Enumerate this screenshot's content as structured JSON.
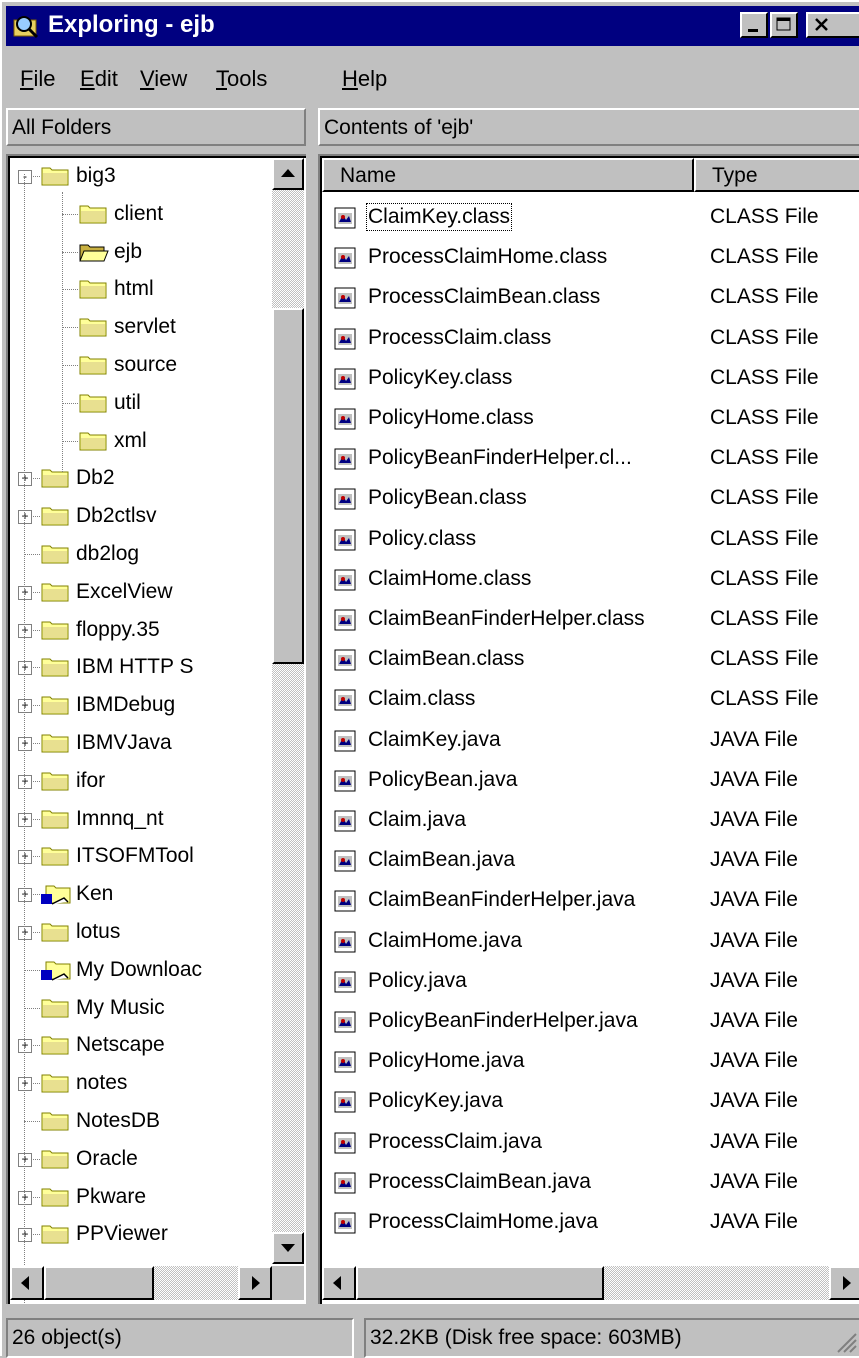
{
  "window": {
    "title": "Exploring - ejb",
    "app_icon": "explorer-icon"
  },
  "menu": [
    "File",
    "Edit",
    "View",
    "Tools",
    "Help"
  ],
  "menu_accel": [
    "F",
    "E",
    "V",
    "T",
    "H"
  ],
  "left_header": "All Folders",
  "right_header": "Contents of 'ejb'",
  "tree": [
    {
      "label": "big3",
      "level": 0,
      "expander": "-",
      "icon": "folder-icon"
    },
    {
      "label": "client",
      "level": 1,
      "expander": "",
      "icon": "folder-icon"
    },
    {
      "label": "ejb",
      "level": 1,
      "expander": "",
      "icon": "open-folder-icon"
    },
    {
      "label": "html",
      "level": 1,
      "expander": "",
      "icon": "folder-icon"
    },
    {
      "label": "servlet",
      "level": 1,
      "expander": "",
      "icon": "folder-icon"
    },
    {
      "label": "source",
      "level": 1,
      "expander": "",
      "icon": "folder-icon"
    },
    {
      "label": "util",
      "level": 1,
      "expander": "",
      "icon": "folder-icon"
    },
    {
      "label": "xml",
      "level": 1,
      "expander": "",
      "icon": "folder-icon"
    },
    {
      "label": "Db2",
      "level": 0,
      "expander": "+",
      "icon": "folder-icon"
    },
    {
      "label": "Db2ctlsv",
      "level": 0,
      "expander": "+",
      "icon": "folder-icon"
    },
    {
      "label": "db2log",
      "level": 0,
      "expander": "",
      "icon": "folder-icon"
    },
    {
      "label": "ExcelView",
      "level": 0,
      "expander": "+",
      "icon": "folder-icon"
    },
    {
      "label": "floppy.35",
      "level": 0,
      "expander": "+",
      "icon": "folder-icon"
    },
    {
      "label": "IBM HTTP S",
      "level": 0,
      "expander": "+",
      "icon": "folder-icon"
    },
    {
      "label": "IBMDebug",
      "level": 0,
      "expander": "+",
      "icon": "folder-icon"
    },
    {
      "label": "IBMVJava",
      "level": 0,
      "expander": "+",
      "icon": "folder-icon"
    },
    {
      "label": "ifor",
      "level": 0,
      "expander": "+",
      "icon": "folder-icon"
    },
    {
      "label": "Imnnq_nt",
      "level": 0,
      "expander": "+",
      "icon": "folder-icon"
    },
    {
      "label": "ITSOFMTool",
      "level": 0,
      "expander": "+",
      "icon": "folder-icon"
    },
    {
      "label": "Ken",
      "level": 0,
      "expander": "+",
      "icon": "shared-folder-icon"
    },
    {
      "label": "lotus",
      "level": 0,
      "expander": "+",
      "icon": "folder-icon"
    },
    {
      "label": "My Downloac",
      "level": 0,
      "expander": "",
      "icon": "shared-folder-icon"
    },
    {
      "label": "My Music",
      "level": 0,
      "expander": "",
      "icon": "folder-icon"
    },
    {
      "label": "Netscape",
      "level": 0,
      "expander": "+",
      "icon": "folder-icon"
    },
    {
      "label": "notes",
      "level": 0,
      "expander": "+",
      "icon": "folder-icon"
    },
    {
      "label": "NotesDB",
      "level": 0,
      "expander": "",
      "icon": "folder-icon"
    },
    {
      "label": "Oracle",
      "level": 0,
      "expander": "+",
      "icon": "folder-icon"
    },
    {
      "label": "Pkware",
      "level": 0,
      "expander": "+",
      "icon": "folder-icon"
    },
    {
      "label": "PPViewer",
      "level": 0,
      "expander": "+",
      "icon": "folder-icon"
    }
  ],
  "columns": [
    "Name",
    "Type"
  ],
  "files": [
    {
      "name": "ClaimKey.class",
      "type": "CLASS File"
    },
    {
      "name": "ProcessClaimHome.class",
      "type": "CLASS File"
    },
    {
      "name": "ProcessClaimBean.class",
      "type": "CLASS File"
    },
    {
      "name": "ProcessClaim.class",
      "type": "CLASS File"
    },
    {
      "name": "PolicyKey.class",
      "type": "CLASS File"
    },
    {
      "name": "PolicyHome.class",
      "type": "CLASS File"
    },
    {
      "name": "PolicyBeanFinderHelper.cl...",
      "type": "CLASS File"
    },
    {
      "name": "PolicyBean.class",
      "type": "CLASS File"
    },
    {
      "name": "Policy.class",
      "type": "CLASS File"
    },
    {
      "name": "ClaimHome.class",
      "type": "CLASS File"
    },
    {
      "name": "ClaimBeanFinderHelper.class",
      "type": "CLASS File"
    },
    {
      "name": "ClaimBean.class",
      "type": "CLASS File"
    },
    {
      "name": "Claim.class",
      "type": "CLASS File"
    },
    {
      "name": "ClaimKey.java",
      "type": "JAVA File"
    },
    {
      "name": "PolicyBean.java",
      "type": "JAVA File"
    },
    {
      "name": "Claim.java",
      "type": "JAVA File"
    },
    {
      "name": "ClaimBean.java",
      "type": "JAVA File"
    },
    {
      "name": "ClaimBeanFinderHelper.java",
      "type": "JAVA File"
    },
    {
      "name": "ClaimHome.java",
      "type": "JAVA File"
    },
    {
      "name": "Policy.java",
      "type": "JAVA File"
    },
    {
      "name": "PolicyBeanFinderHelper.java",
      "type": "JAVA File"
    },
    {
      "name": "PolicyHome.java",
      "type": "JAVA File"
    },
    {
      "name": "PolicyKey.java",
      "type": "JAVA File"
    },
    {
      "name": "ProcessClaim.java",
      "type": "JAVA File"
    },
    {
      "name": "ProcessClaimBean.java",
      "type": "JAVA File"
    },
    {
      "name": "ProcessClaimHome.java",
      "type": "JAVA File"
    }
  ],
  "status": {
    "objects": "26 object(s)",
    "size": "32.2KB (Disk free space: 603MB)"
  }
}
